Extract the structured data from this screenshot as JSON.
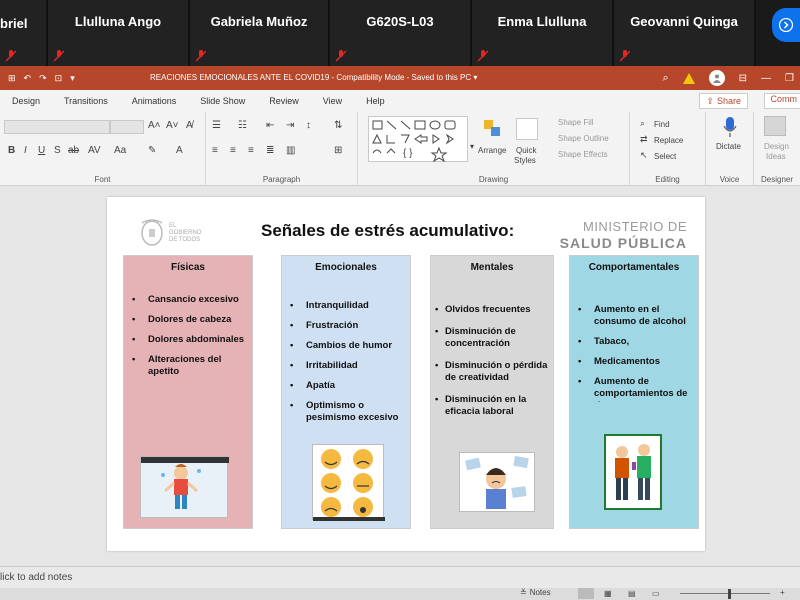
{
  "participants": [
    {
      "name": "briel",
      "width": 48
    },
    {
      "name": "Llulluna Ango",
      "width": 142
    },
    {
      "name": "Gabriela Muñoz",
      "width": 140
    },
    {
      "name": "G620S-L03",
      "width": 142
    },
    {
      "name": "Enma Llulluna",
      "width": 142
    },
    {
      "name": "Geovanni Quinga",
      "width": 142
    }
  ],
  "titlebar": {
    "doc_title": "REACIONES EMOCIONALES ANTE EL COVID19  -  Compatibility Mode  -  Saved to this PC  ▾"
  },
  "tabs": [
    "Design",
    "Transitions",
    "Animations",
    "Slide Show",
    "Review",
    "View",
    "Help"
  ],
  "share_label": "Share",
  "comments_label": "Comm",
  "ribbon": {
    "font_label": "Font",
    "paragraph_label": "Paragraph",
    "drawing_label": "Drawing",
    "editing_label": "Editing",
    "voice_label": "Voice",
    "designer_label": "Designer",
    "arrange": "Arrange",
    "quick_styles_1": "Quick",
    "quick_styles_2": "Styles",
    "shape_fill": "Shape Fill",
    "shape_outline": "Shape Outline",
    "shape_effects": "Shape Effects",
    "find": "Find",
    "replace": "Replace",
    "select": "Select",
    "dictate": "Dictate",
    "design_ideas_1": "Design",
    "design_ideas_2": "Ideas"
  },
  "slide": {
    "title": "Señales de estrés acumulativo:",
    "gov_logo_text": "EL GOBIERNO DE TODOS",
    "ministry_line1": "MINISTERIO DE",
    "ministry_line2": "SALUD PÚBLICA",
    "columns": [
      {
        "title": "Físicas",
        "items": [
          "Cansancio excesivo",
          "Dolores de cabeza",
          "Dolores abdominales",
          "Alteraciones del apetito"
        ],
        "color": "#e5b2b5"
      },
      {
        "title": "Emocionales",
        "items": [
          "Intranquilidad",
          "Frustración",
          "Cambios de humor",
          "Irritabilidad",
          "Apatía",
          "Optimismo o pesimismo excesivo"
        ],
        "color": "#cfe0f3"
      },
      {
        "title": "Mentales",
        "items": [
          "Olvidos frecuentes",
          "Disminución de concentración",
          "Disminución o pérdida de creatividad",
          "Disminución en la eficacia laboral"
        ],
        "color": "#d8d8d8"
      },
      {
        "title": "Comportamentales",
        "items": [
          "Aumento en el consumo de alcohol",
          "Tabaco,",
          "Medicamentos",
          "Aumento de comportamientos de riesgo."
        ],
        "color": "#9fd8e4"
      }
    ]
  },
  "notes_placeholder": "lick to add notes",
  "status": {
    "notes_label": "Notes"
  }
}
